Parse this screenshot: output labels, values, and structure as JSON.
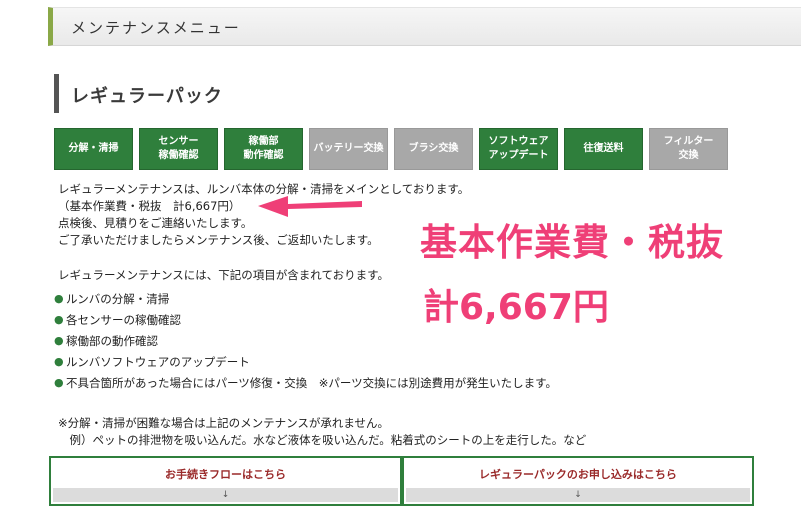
{
  "header": {
    "title": "メンテナンスメニュー"
  },
  "section": {
    "title": "レギュラーパック"
  },
  "tabs": [
    {
      "label": "分解・清掃",
      "active": true
    },
    {
      "label": "センサー\n稼働確認",
      "active": true
    },
    {
      "label": "稼働部\n動作確認",
      "active": true
    },
    {
      "label": "バッテリー交換",
      "active": false
    },
    {
      "label": "ブラシ交換",
      "active": false
    },
    {
      "label": "ソフトウェア\nアップデート",
      "active": true
    },
    {
      "label": "往復送料",
      "active": true
    },
    {
      "label": "フィルター\n交換",
      "active": false
    }
  ],
  "description": {
    "line1": "レギュラーメンテナンスは、ルンバ本体の分解・清掃をメインとしております。",
    "line2": "（基本作業費・税抜　計6,667円）",
    "line3": "点検後、見積りをご連絡いたします。",
    "line4": "ご了承いただけましたらメンテナンス後、ご返却いたします。"
  },
  "items_intro": "レギュラーメンテナンスには、下記の項目が含まれております。",
  "items": [
    "ルンバの分解・清掃",
    "各センサーの稼働確認",
    "稼働部の動作確認",
    "ルンバソフトウェアのアップデート",
    "不具合箇所があった場合にはパーツ修復・交換　※パーツ交換には別途費用が発生いたします。"
  ],
  "bullet": "●",
  "notes": {
    "line1": "※分解・清掃が困難な場合は上記のメンテナンスが承れません。",
    "line2": "　例）ペットの排泄物を吸い込んだ。水など液体を吸い込んだ。粘着式のシートの上を走行した。など"
  },
  "overlay": {
    "line1": "基本作業費・税抜",
    "line2": "計6,667円",
    "color": "#ef3f77"
  },
  "buttons": {
    "flow_label": "お手続きフローはこちら",
    "apply_label": "レギュラーパックのお申し込みはこちら",
    "down_arrow": "↓"
  },
  "colors": {
    "accent_green": "#2f7f3c",
    "inactive_gray": "#a8a8a8"
  }
}
